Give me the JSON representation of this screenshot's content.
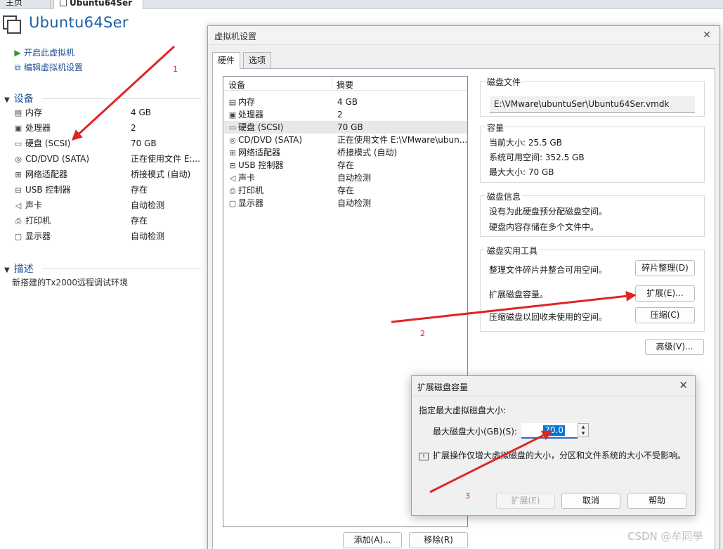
{
  "tabs": {
    "home": "主页",
    "vm": "Ubuntu64Ser"
  },
  "vm": {
    "name": "Ubuntu64Ser",
    "actions": {
      "power_on": "开启此虚拟机",
      "edit_settings": "编辑虚拟机设置"
    },
    "devices_title": "设备",
    "devices": [
      {
        "icon": "memory-icon",
        "name": "内存",
        "value": "4 GB"
      },
      {
        "icon": "cpu-icon",
        "name": "处理器",
        "value": "2"
      },
      {
        "icon": "disk-icon",
        "name": "硬盘 (SCSI)",
        "value": "70 GB"
      },
      {
        "icon": "cd-icon",
        "name": "CD/DVD (SATA)",
        "value": "正在使用文件 E:..."
      },
      {
        "icon": "network-icon",
        "name": "网络适配器",
        "value": "桥接模式 (自动)"
      },
      {
        "icon": "usb-icon",
        "name": "USB 控制器",
        "value": "存在"
      },
      {
        "icon": "sound-icon",
        "name": "声卡",
        "value": "自动检测"
      },
      {
        "icon": "printer-icon",
        "name": "打印机",
        "value": "存在"
      },
      {
        "icon": "display-icon",
        "name": "显示器",
        "value": "自动检测"
      }
    ],
    "description_title": "描述",
    "description": "新搭建的Tx2000远程调试环境"
  },
  "settings": {
    "title": "虚拟机设置",
    "tabs": {
      "hardware": "硬件",
      "options": "选项"
    },
    "columns": {
      "device": "设备",
      "summary": "摘要"
    },
    "devices": [
      {
        "name": "内存",
        "summary": "4 GB"
      },
      {
        "name": "处理器",
        "summary": "2"
      },
      {
        "name": "硬盘 (SCSI)",
        "summary": "70 GB"
      },
      {
        "name": "CD/DVD (SATA)",
        "summary": "正在使用文件 E:\\VMware\\ubun..."
      },
      {
        "name": "网络适配器",
        "summary": "桥接模式 (自动)"
      },
      {
        "name": "USB 控制器",
        "summary": "存在"
      },
      {
        "name": "声卡",
        "summary": "自动检测"
      },
      {
        "name": "打印机",
        "summary": "存在"
      },
      {
        "name": "显示器",
        "summary": "自动检测"
      }
    ],
    "disk_file": {
      "title": "磁盘文件",
      "path": "E:\\VMware\\ubuntuSer\\Ubuntu64Ser.vmdk"
    },
    "capacity": {
      "title": "容量",
      "current": "当前大小: 25.5 GB",
      "available": "系统可用空间: 352.5 GB",
      "max": "最大大小: 70 GB"
    },
    "disk_info": {
      "title": "磁盘信息",
      "line1": "没有为此硬盘预分配磁盘空间。",
      "line2": "硬盘内容存储在多个文件中。"
    },
    "utilities": {
      "title": "磁盘实用工具",
      "defrag_text": "整理文件碎片并整合可用空间。",
      "defrag_btn": "碎片整理(D)",
      "expand_text": "扩展磁盘容量。",
      "expand_btn": "扩展(E)...",
      "compact_text": "压缩磁盘以回收未使用的空间。",
      "compact_btn": "压缩(C)"
    },
    "advanced_btn": "高级(V)...",
    "add_btn": "添加(A)...",
    "remove_btn": "移除(R)"
  },
  "expand_dialog": {
    "title": "扩展磁盘容量",
    "prompt": "指定最大虚拟磁盘大小:",
    "size_label": "最大磁盘大小(GB)(S):",
    "size_value": "70.0",
    "info": "扩展操作仅增大虚拟磁盘的大小，分区和文件系统的大小不受影响。",
    "buttons": {
      "expand": "扩展(E)",
      "cancel": "取消",
      "help": "帮助"
    }
  },
  "annotations": [
    "1",
    "2",
    "3"
  ],
  "watermark": "CSDN @牟同學",
  "colors": {
    "accent": "#1c5fa8",
    "arrow": "#e02424",
    "selection": "#0078d7"
  }
}
